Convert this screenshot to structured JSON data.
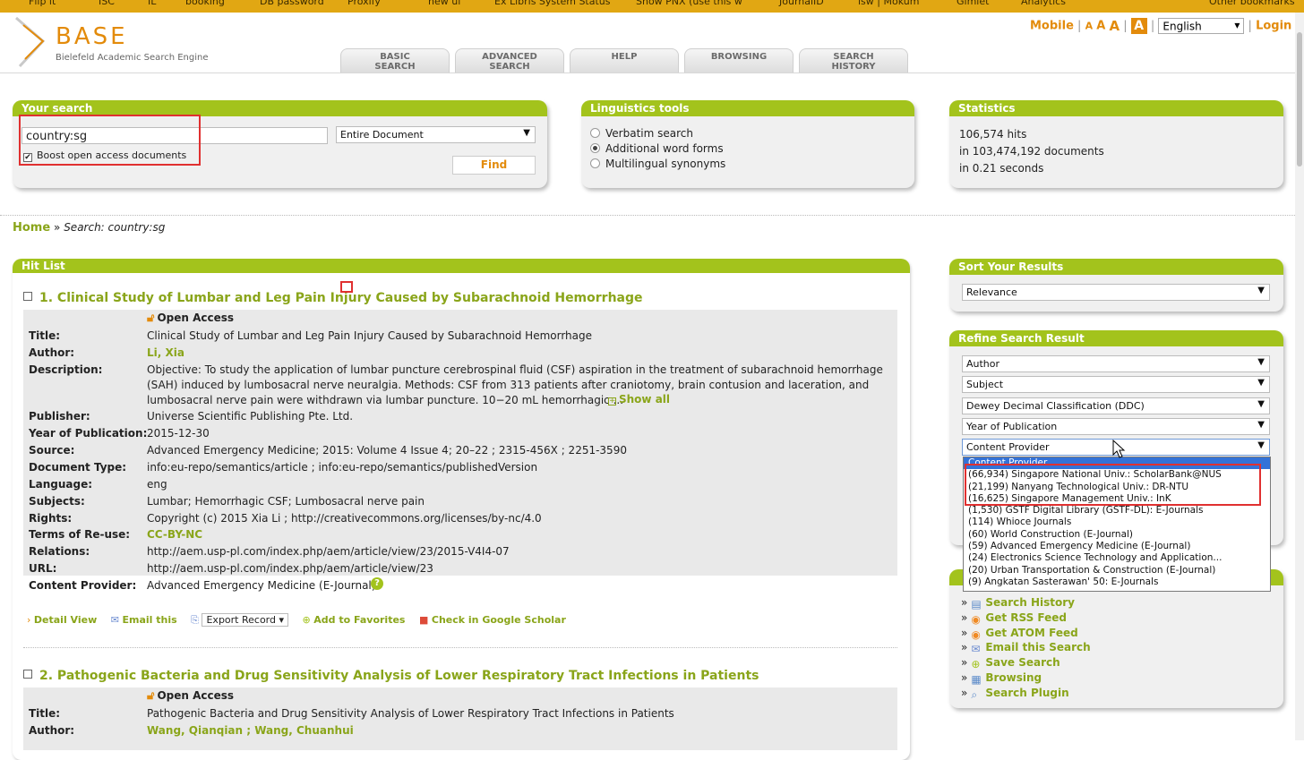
{
  "bookmarks": [
    "Flip it",
    "ISC",
    "IL",
    "booking",
    "DB password",
    "Proxify",
    "new ui",
    "Ex Libris System Status",
    "Show PNX (use this w",
    "JournalID",
    "isw | Mokum",
    "Gimlet",
    "Analytics",
    "Other bookmarks"
  ],
  "header": {
    "logo_word": "BASE",
    "logo_sub": "Bielefeld Academic Search Engine",
    "tabs": [
      "BASIC\nSEARCH",
      "ADVANCED\nSEARCH",
      "HELP",
      "BROWSING",
      "SEARCH\nHISTORY"
    ],
    "mobile": "Mobile",
    "font_sizes": [
      "A",
      "A",
      "A"
    ],
    "contrast": "A",
    "language": "English",
    "login": "Login"
  },
  "search_panel": {
    "title": "Your search",
    "query": "country:sg",
    "scope": "Entire Document",
    "boost_label": "Boost open access documents",
    "boost_checked": true,
    "find_label": "Find"
  },
  "ling_panel": {
    "title": "Linguistics tools",
    "options": [
      "Verbatim search",
      "Additional word forms",
      "Multilingual synonyms"
    ],
    "selected_index": 1
  },
  "stats_panel": {
    "title": "Statistics",
    "hits": "106,574 hits",
    "documents": "in 103,474,192 documents",
    "time": "in 0.21 seconds"
  },
  "breadcrumb": {
    "home": "Home",
    "sep": "»",
    "current": "Search: country:sg"
  },
  "hitlist": {
    "title": "Hit List",
    "items": [
      {
        "title": "1. Clinical Study of Lumbar and Leg Pain Injury Caused by Subarachnoid Hemorrhage",
        "open_access": "Open Access",
        "fields": [
          {
            "k": "Title:",
            "v": "Clinical Study of Lumbar and Leg Pain Injury Caused by Subarachnoid Hemorrhage"
          },
          {
            "k": "Author:",
            "v": "Li, Xia"
          },
          {
            "k": "Description:",
            "v": "Objective: To study the application of lumbar puncture cerebrospinal fluid (CSF) aspiration in the treatment of subarachnoid hemorrhage"
          },
          {
            "k": "",
            "v": "(SAH) induced by lumbosacral nerve neuralgia. Methods: CSF from 313 patients after craniotomy, brain contusion and laceration, and"
          },
          {
            "k": "",
            "v": "lumbosacral nerve pain were withdrawn via lumbar puncture. 10−20 mL hemorrhagic ..."
          },
          {
            "k": "Publisher:",
            "v": "Universe Scientific Publishing Pte. Ltd."
          },
          {
            "k": "Year of Publication:",
            "v": "2015-12-30"
          },
          {
            "k": "Source:",
            "v": "Advanced Emergency Medicine; 2015: Volume 4 Issue 4; 20–22 ; 2315-456X ; 2251-3590"
          },
          {
            "k": "Document Type:",
            "v": "info:eu-repo/semantics/article ; info:eu-repo/semantics/publishedVersion"
          },
          {
            "k": "Language:",
            "v": "eng"
          },
          {
            "k": "Subjects:",
            "v": "Lumbar; Hemorrhagic CSF; Lumbosacral nerve pain"
          },
          {
            "k": "Rights:",
            "v": "Copyright (c) 2015 Xia Li ; http://creativecommons.org/licenses/by-nc/4.0"
          },
          {
            "k": "Terms of Re-use:",
            "v": "CC-BY-NC"
          },
          {
            "k": "Relations:",
            "v": "http://aem.usp-pl.com/index.php/aem/article/view/23/2015-V4I4-07"
          },
          {
            "k": "URL:",
            "v": "http://aem.usp-pl.com/index.php/aem/article/view/23"
          },
          {
            "k": "Content Provider:",
            "v": "Advanced Emergency Medicine (E-Journal)"
          }
        ],
        "show_all": "Show all",
        "actions": {
          "detail": "Detail View",
          "email": "Email this",
          "export": "Export Record",
          "favorites": "Add to Favorites",
          "scholar": "Check in Google Scholar"
        }
      },
      {
        "title": "2. Pathogenic Bacteria and Drug Sensitivity Analysis of Lower Respiratory Tract Infections in Patients",
        "open_access": "Open Access",
        "fields": [
          {
            "k": "Title:",
            "v": "Pathogenic Bacteria and Drug Sensitivity Analysis of Lower Respiratory Tract Infections in Patients"
          },
          {
            "k": "Author:",
            "v": "Wang, Qianqian ; Wang, Chuanhui"
          }
        ]
      }
    ]
  },
  "sort_panel": {
    "title": "Sort Your Results",
    "value": "Relevance"
  },
  "refine_panel": {
    "title": "Refine Search Result",
    "selects": [
      "Author",
      "Subject",
      "Dewey Decimal Classification (DDC)",
      "Year of Publication",
      "Content Provider"
    ],
    "dropdown_options": [
      "Content Provider",
      "(66,934) Singapore National Univ.: ScholarBank@NUS",
      "(21,199) Nanyang Technological Univ.: DR-NTU",
      "(16,625) Singapore Management Univ.: InK",
      "(1,530) GSTF Digital Library (GSTF-DL): E-Journals",
      "(114) Whioce Journals",
      "(60) World Construction (E-Journal)",
      "(59) Advanced Emergency Medicine (E-Journal)",
      "(24) Electronics Science Technology and Application...",
      "(20) Urban Transportation & Construction (E-Journal)",
      "(9) Angkatan Sasterawan' 50: E-Journals"
    ],
    "highlighted_index": 0
  },
  "tools_links": [
    "Search History",
    "Get RSS Feed",
    "Get ATOM Feed",
    "Email this Search",
    "Save Search",
    "Browsing",
    "Search Plugin"
  ],
  "colors": {
    "accent": "#a3c31c",
    "link": "#8aa51a",
    "brand": "#e38b0b",
    "highlight": "#e03030"
  }
}
